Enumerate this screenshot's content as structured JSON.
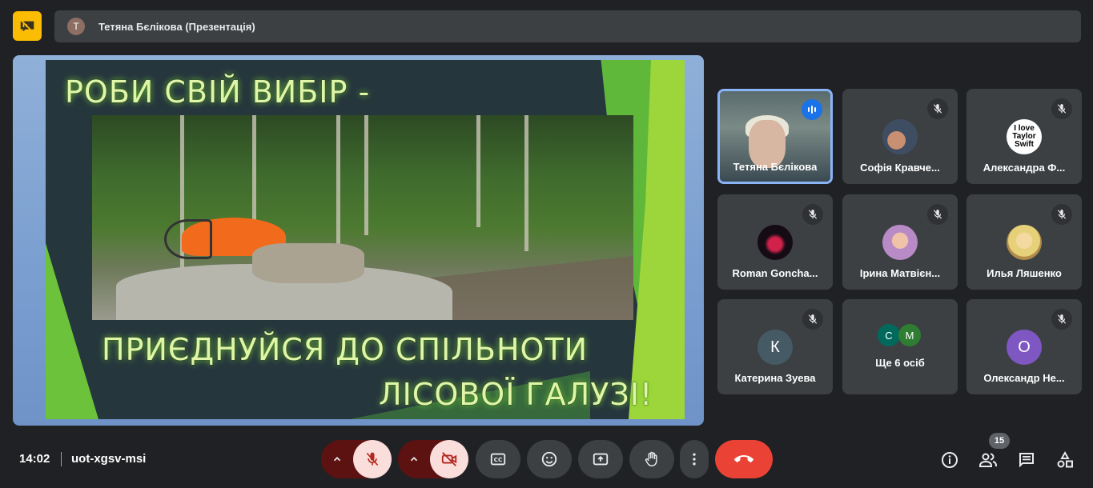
{
  "header": {
    "avatar_letter": "T",
    "title": "Тетяна Бєлікова (Презентація)"
  },
  "slide": {
    "line1": "РОБИ СВІЙ ВИБІР -",
    "line2": "ПРИЄДНУЙСЯ ДО СПІЛЬНОТИ",
    "line3": "ЛІСОВОЇ ГАЛУЗІ!"
  },
  "participants": [
    {
      "name": "Тетяна Бєлікова"
    },
    {
      "name": "Софія Кравче..."
    },
    {
      "name": "Александра Ф...",
      "avatar_text_1": "I love",
      "avatar_text_2": "Taylor",
      "avatar_text_3": "Swift"
    },
    {
      "name": "Roman Goncha..."
    },
    {
      "name": "Ірина Матвієн..."
    },
    {
      "name": "Илья Ляшенко"
    },
    {
      "name": "Катерина Зуева",
      "avatar_letter": "К"
    },
    {
      "name": "Ще 6 осіб",
      "mini1": "С",
      "mini2": "М"
    },
    {
      "name": "Олександр Не...",
      "avatar_letter": "О"
    }
  ],
  "footer": {
    "time": "14:02",
    "meeting_code": "uot-xgsv-msi",
    "people_count": "15"
  },
  "colors": {
    "background": "#202124",
    "tile": "#3c4043",
    "accent_blue": "#8ab4f8",
    "end_call": "#ea4335",
    "logo": "#fbbc04"
  },
  "icons": [
    "presentation-off-icon",
    "mic-off-icon",
    "speaking-icon",
    "chevron-up-icon",
    "camera-off-icon",
    "captions-icon",
    "emoji-icon",
    "present-icon",
    "raise-hand-icon",
    "more-vert-icon",
    "end-call-icon",
    "info-icon",
    "people-icon",
    "chat-icon",
    "activities-icon"
  ]
}
